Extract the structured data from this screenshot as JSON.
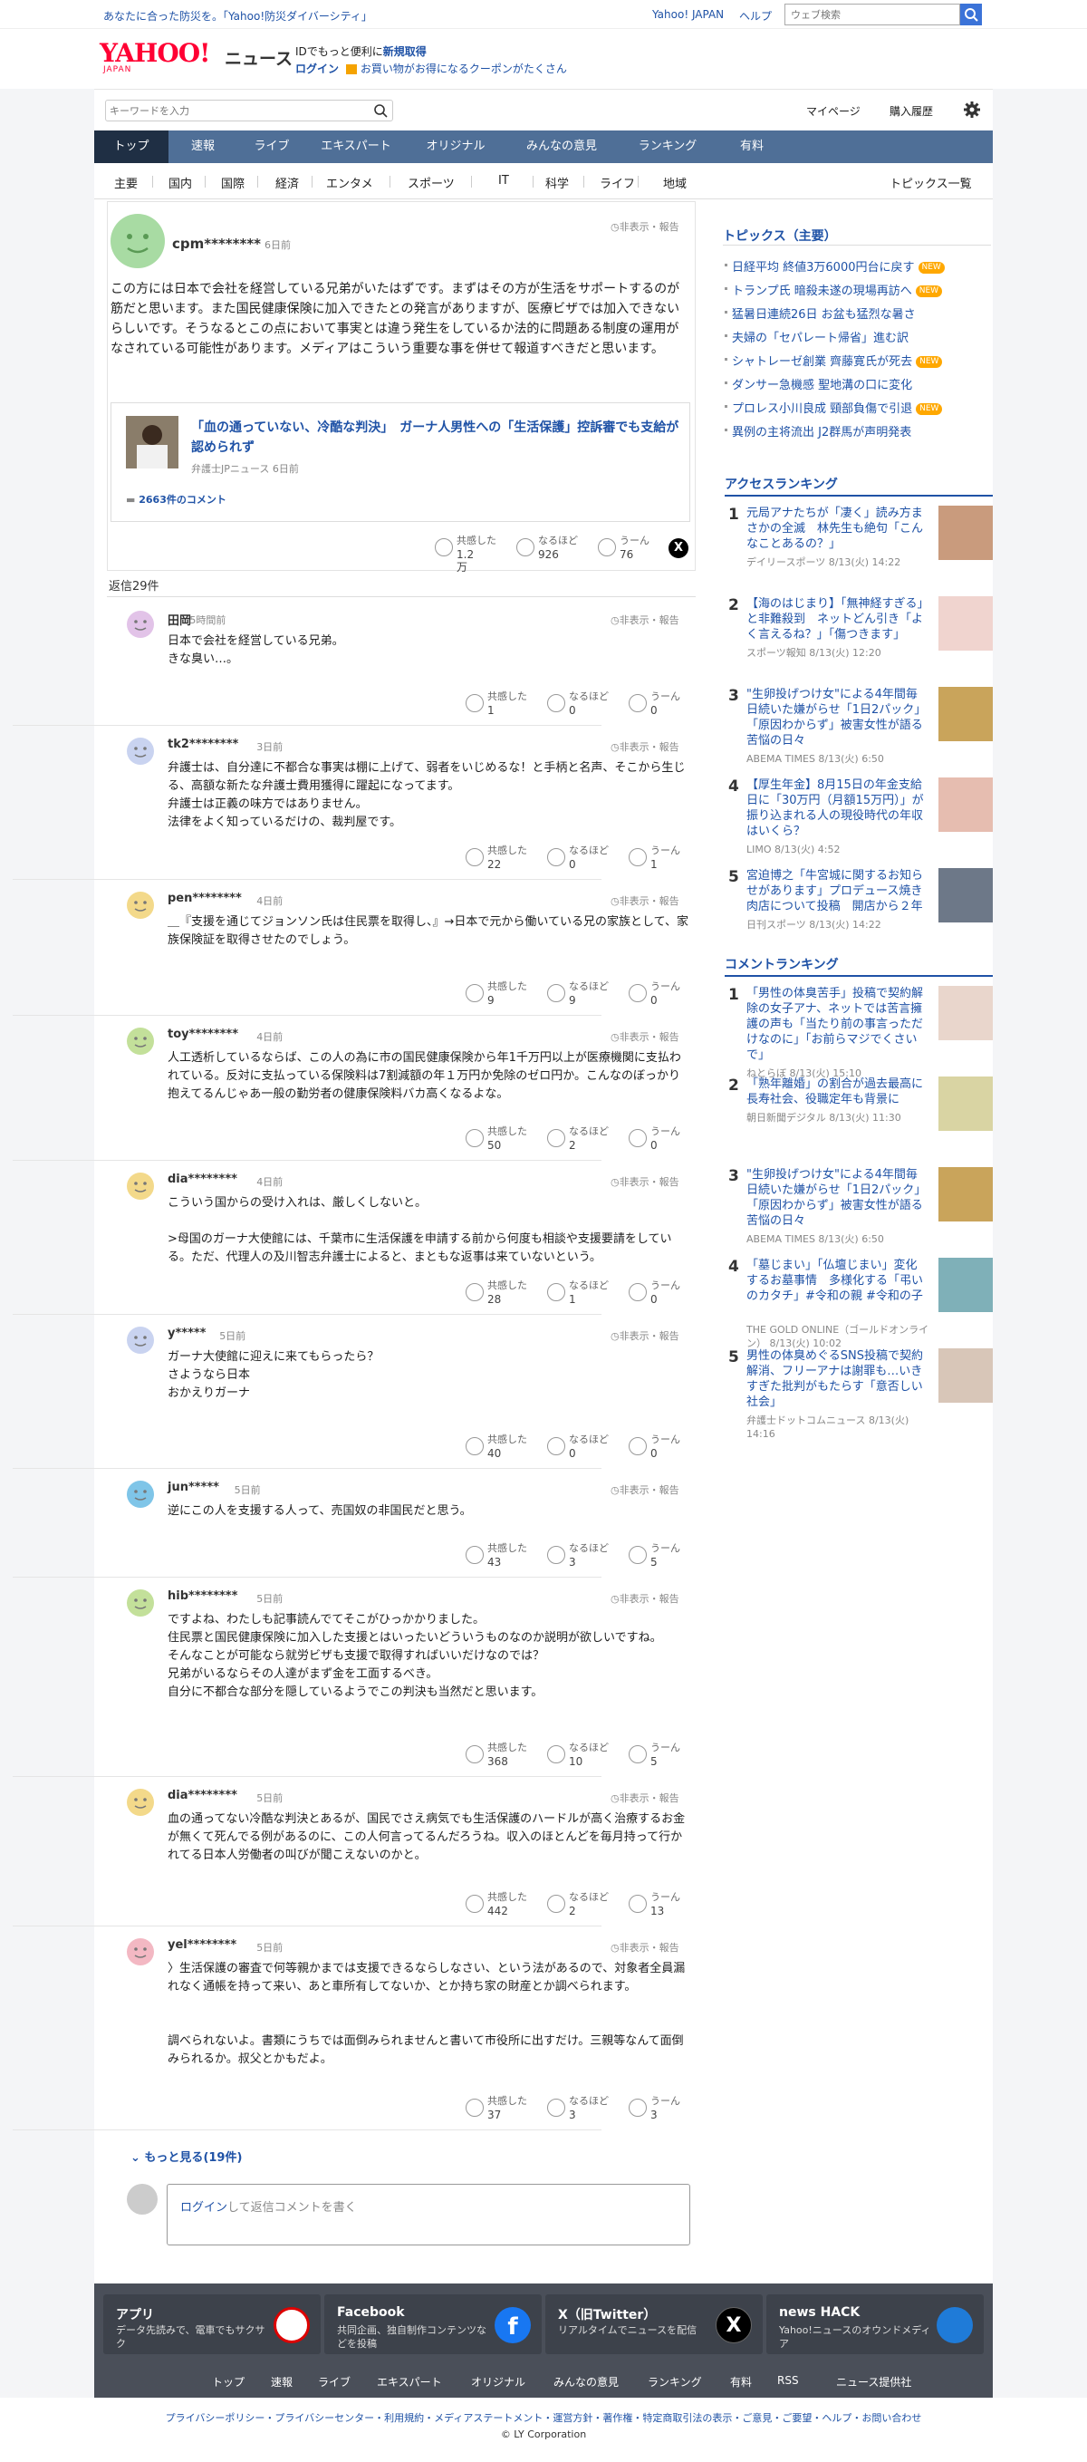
{
  "topbar": {
    "promo": "あなたに合った防災を。「Yahoo!防災ダイバーシティ」",
    "links": [
      "Yahoo! JAPAN",
      "ヘルプ"
    ],
    "search_placeholder": "ウェブ検索"
  },
  "header": {
    "logo": "YAHOO!",
    "logo_sub": "JAPAN",
    "logo_news": "ニュース",
    "promo1_prefix": "IDでもっと便利に",
    "promo1_link": "新規取得",
    "login": "ログイン",
    "promo2": "お買い物がお得になるクーポンがたくさん"
  },
  "search": {
    "placeholder": "キーワードを入力",
    "links": [
      "マイページ",
      "購入履歴"
    ]
  },
  "nav": [
    "トップ",
    "速報",
    "ライブ",
    "エキスパート",
    "オリジナル",
    "みんなの意見",
    "ランキング",
    "有料"
  ],
  "subnav": [
    "主要",
    "国内",
    "国際",
    "経済",
    "エンタメ",
    "スポーツ",
    "IT",
    "科学",
    "ライフ",
    "地域"
  ],
  "subnav_right": "トピックス一覧",
  "main_comment": {
    "user": "cpm********",
    "time": "6日前",
    "hide": "非表示・報告",
    "text": "この方には日本で会社を経営している兄弟がいたはずです。まずはその方が生活をサポートするのが筋だと思います。また国民健康保険に加入できたとの発言がありますが、医療ビザでは加入できないらしいです。そうなるとこの点において事実とは違う発生をしているか法的に問題ある制度の運用がなされている可能性があります。メディアはこういう重要な事を併せて報道すべきだと思います。",
    "article": {
      "title": "「血の通っていない、冷酷な判決」　ガーナ人男性への「生活保護」控訴審でも支給が認められず",
      "source": "弁護士JPニュース",
      "time": "6日前",
      "comments": "2663件のコメント"
    },
    "reactions": [
      {
        "label": "共感した",
        "value": "1.2万"
      },
      {
        "label": "なるほど",
        "value": "926"
      },
      {
        "label": "うーん",
        "value": "76"
      }
    ]
  },
  "reply_count": "返信29件",
  "replies": [
    {
      "user": "田岡",
      "time": "5時間前",
      "text": "日本で会社を経営している兄弟。\nきな臭い…。",
      "r": [
        "1",
        "0",
        "0"
      ]
    },
    {
      "user": "tk2********",
      "time": "3日前",
      "text": "弁護士は、自分達に不都合な事実は棚に上げて、弱者をいじめるな！と手柄と名声、そこから生じる、高額な新たな弁護士費用獲得に躍起になってます。\n弁護士は正義の味方ではありません。\n法律をよく知っているだけの、裁判屋です。",
      "r": [
        "22",
        "0",
        "1"
      ]
    },
    {
      "user": "pen********",
      "time": "4日前",
      "text": "＿『支援を通じてジョンソン氏は住民票を取得し、』→日本で元から働いている兄の家族として、家族保険証を取得させたのでしょう。",
      "r": [
        "9",
        "9",
        "0"
      ]
    },
    {
      "user": "toy********",
      "time": "4日前",
      "text": "人工透析しているならば、この人の為に市の国民健康保険から年1千万円以上が医療機関に支払われている。反対に支払っている保険料は7割減額の年１万円か免除のゼロ円か。こんなのぼっかり抱えてるんじゃあ一般の勤労者の健康保険料バカ高くなるよな。",
      "r": [
        "50",
        "2",
        "0"
      ]
    },
    {
      "user": "dia********",
      "time": "4日前",
      "text": "こういう国からの受け入れは、厳しくしないと。\n\n>母国のガーナ大使館には、千葉市に生活保護を申請する前から何度も相談や支援要請をしている。ただ、代理人の及川智志弁護士によると、まともな返事は来ていないという。",
      "r": [
        "28",
        "1",
        "0"
      ]
    },
    {
      "user": "y*****",
      "time": "5日前",
      "text": "ガーナ大使館に迎えに来てもらったら？\nさようなら日本\nおかえりガーナ",
      "r": [
        "40",
        "0",
        "0"
      ]
    },
    {
      "user": "jun*****",
      "time": "5日前",
      "text": "逆にこの人を支援する人って、売国奴の非国民だと思う。",
      "r": [
        "43",
        "3",
        "5"
      ]
    },
    {
      "user": "hib********",
      "time": "5日前",
      "text": "ですよね、わたしも記事読んでてそこがひっかかりました。\n住民票と国民健康保険に加入した支援とはいったいどういうものなのか説明が欲しいですね。\nそんなことが可能なら就労ビザも支援で取得すればいいだけなのでは？\n兄弟がいるならその人達がまず金を工面するべき。\n自分に不都合な部分を隠しているようでこの判決も当然だと思います。",
      "r": [
        "368",
        "10",
        "5"
      ]
    },
    {
      "user": "dia********",
      "time": "5日前",
      "text": "血の通ってない冷酷な判決とあるが、国民でさえ病気でも生活保護のハードルが高く治療するお金が無くて死んでる例があるのに、この人何言ってるんだろうね。収入のほとんどを毎月持って行かれてる日本人労働者の叫びが聞こえないのかと。",
      "r": [
        "442",
        "2",
        "13"
      ]
    },
    {
      "user": "yel********",
      "time": "5日前",
      "text": "〉生活保護の審査で何等親かまでは支援できるならしなさい、という法があるので、対象者全員漏れなく通帳を持って来い、あと車所有してないか、とか持ち家の財産とか調べられます。\n\n\n調べられないよ。書類にうちでは面倒みられませんと書いて市役所に出すだけ。三親等なんて面倒みられるか。叔父とかもだよ。",
      "r": [
        "37",
        "3",
        "3"
      ]
    }
  ],
  "more": {
    "label": "もっと見る",
    "count": "(19件)"
  },
  "reply_box": {
    "login": "ログイン",
    "rest": "して返信コメントを書く"
  },
  "topics": {
    "title": "トピックス（主要）",
    "items": [
      {
        "t": "日経平均 終値3万6000円台に戻す",
        "new": true
      },
      {
        "t": "トランプ氏 暗殺未遂の現場再訪へ",
        "new": true
      },
      {
        "t": "猛暑日連続26日 お盆も猛烈な暑さ",
        "new": false
      },
      {
        "t": "夫婦の「セパレート帰省」進む訳",
        "new": false
      },
      {
        "t": "シャトレーゼ創業 齊藤寛氏が死去",
        "new": true
      },
      {
        "t": "ダンサー急機感 聖地溝の口に変化",
        "new": false
      },
      {
        "t": "プロレス小川良成 頸部負傷で引退",
        "new": true
      },
      {
        "t": "異例の主将流出 J2群馬が声明発表",
        "new": false
      }
    ],
    "new_label": "NEW"
  },
  "access": {
    "title": "アクセスランキング",
    "items": [
      {
        "n": "1",
        "t": "元局アナたちが「凄く」読み方まさかの全滅　林先生も絶句「こんなことあるの？」",
        "s": "デイリースポーツ 8/13(火) 14:22"
      },
      {
        "n": "2",
        "t": "【海のはじまり】「無神経すぎる」と非難殺到　ネットどん引き「よく言えるね？」「傷つきます」",
        "s": "スポーツ報知 8/13(火) 12:20"
      },
      {
        "n": "3",
        "t": "\"生卵投げつけ女\"による4年間毎日続いた嫌がらせ「1日2パック」「原因わからず」被害女性が語る苦悩の日々",
        "s": "ABEMA TIMES 8/13(火) 6:50"
      },
      {
        "n": "4",
        "t": "【厚生年金】8月15日の年金支給日に「30万円（月額15万円）」が振り込まれる人の現役時代の年収はいくら？",
        "s": "LIMO 8/13(火) 4:52"
      },
      {
        "n": "5",
        "t": "宮迫博之「牛宮城に関するお知らせがあります」プロデュース焼き肉店について投稿　開店から２年",
        "s": "日刊スポーツ 8/13(火) 14:22"
      }
    ]
  },
  "comment_rank": {
    "title": "コメントランキング",
    "items": [
      {
        "n": "1",
        "t": "「男性の体臭苦手」投稿で契約解除の女子アナ、ネットでは苦言擁護の声も「当たり前の事言っただけなのに」「お前らマジでくさいで」",
        "s": "ねとらぼ 8/13(火) 15:10"
      },
      {
        "n": "2",
        "t": "「熟年離婚」の割合が過去最高に　長寿社会、役職定年も背景に",
        "s": "朝日新聞デジタル 8/13(火) 11:30"
      },
      {
        "n": "3",
        "t": "\"生卵投げつけ女\"による4年間毎日続いた嫌がらせ「1日2パック」「原因わからず」被害女性が語る苦悩の日々",
        "s": "ABEMA TIMES 8/13(火) 6:50"
      },
      {
        "n": "4",
        "t": "「墓じまい」「仏壇じまい」変化するお墓事情　多様化する「弔いのカタチ」#令和の親 #令和の子",
        "s": "THE GOLD ONLINE（ゴールドオンライン） 8/13(火) 10:02"
      },
      {
        "n": "5",
        "t": "男性の体臭めぐるSNS投稿で契約解消、フリーアナは謝罪も…いきすぎた批判がもたらす「意否しい社会」",
        "s": "弁護士ドットコムニュース 8/13(火) 14:16"
      }
    ]
  },
  "footer": {
    "boxes": [
      {
        "h": "アプリ",
        "d": "データ先読みで、電車でもサクサク"
      },
      {
        "h": "Facebook",
        "d": "共同企画、独自制作コンテンツなどを投稿"
      },
      {
        "h": "X（旧Twitter）",
        "d": "リアルタイムでニュースを配信"
      },
      {
        "h": "news HACK",
        "d": "Yahoo!ニュースのオウンドメディア"
      }
    ],
    "links": [
      "トップ",
      "速報",
      "ライブ",
      "エキスパート",
      "オリジナル",
      "みんなの意見",
      "ランキング",
      "有料",
      "RSS",
      "ニュース提供社"
    ]
  },
  "bottom": {
    "links": "プライバシーポリシー・プライバシーセンター・利用規約・メディアステートメント・運営方針・著作権・特定商取引法の表示・ご意見・ご要望・ヘルプ・お問い合わせ",
    "copyright": "© LY Corporation"
  },
  "colors": {
    "link": "#1f52a6",
    "nav": "#4f6f97",
    "nav_active": "#1f2f44",
    "brand": "#ff0033",
    "new": "#ffa800",
    "footer": "#4a4f59"
  }
}
